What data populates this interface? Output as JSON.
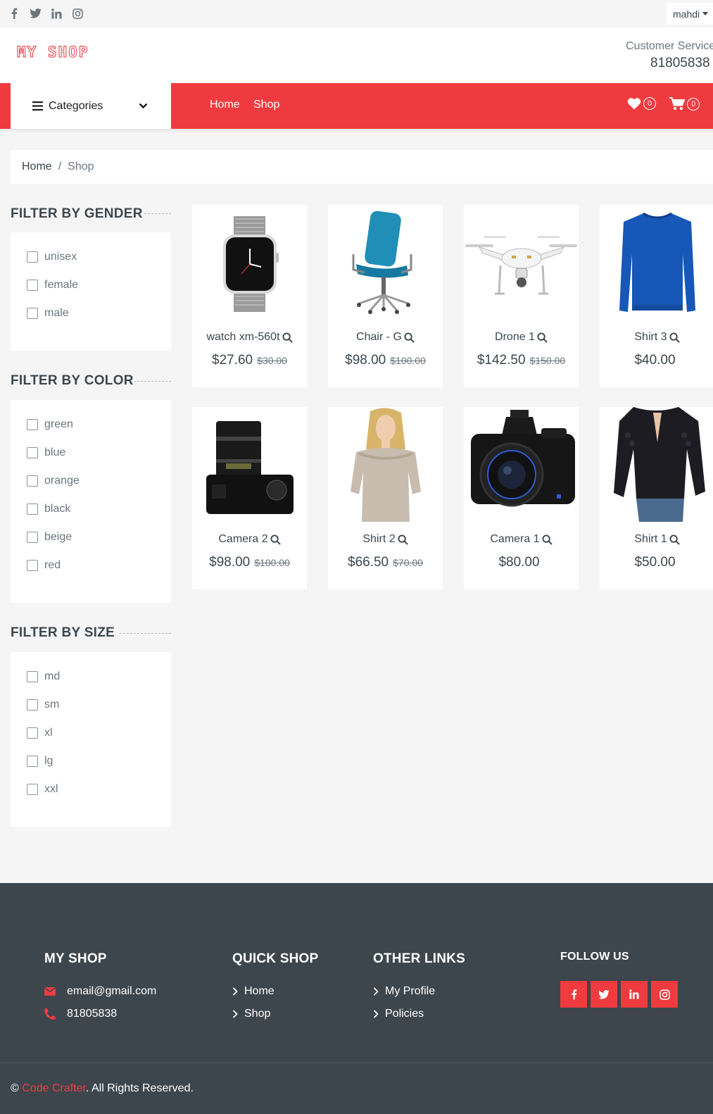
{
  "topbar": {
    "social_icons": [
      "facebook-icon",
      "twitter-icon",
      "linkedin-icon",
      "instagram-icon"
    ],
    "user_menu": "mahdi"
  },
  "header": {
    "logo": "MY SHOP",
    "customer_service_label": "Customer Service",
    "customer_service_phone": "81805838"
  },
  "nav": {
    "categories_label": "Categories",
    "links": [
      "Home",
      "Shop"
    ],
    "wishlist_count": "0",
    "cart_count": "0"
  },
  "breadcrumb": {
    "items": [
      "Home",
      "Shop"
    ],
    "separator": "/"
  },
  "filters": {
    "gender": {
      "title": "FILTER BY GENDER",
      "options": [
        "unisex",
        "female",
        "male"
      ]
    },
    "color": {
      "title": "FILTER BY COLOR",
      "options": [
        "green",
        "blue",
        "orange",
        "black",
        "beige",
        "red"
      ]
    },
    "size": {
      "title": "FILTER BY SIZE",
      "options": [
        "md",
        "sm",
        "xl",
        "lg",
        "xxl"
      ]
    }
  },
  "products": [
    {
      "name": "watch xm-560t",
      "price": "$27.60",
      "old_price": "$30.00"
    },
    {
      "name": "Chair - G",
      "price": "$98.00",
      "old_price": "$100.00"
    },
    {
      "name": "Drone 1",
      "price": "$142.50",
      "old_price": "$150.00"
    },
    {
      "name": "Shirt 3",
      "price": "$40.00",
      "old_price": ""
    },
    {
      "name": "Camera 2",
      "price": "$98.00",
      "old_price": "$100.00"
    },
    {
      "name": "Shirt 2",
      "price": "$66.50",
      "old_price": "$70.00"
    },
    {
      "name": "Camera 1",
      "price": "$80.00",
      "old_price": ""
    },
    {
      "name": "Shirt 1",
      "price": "$50.00",
      "old_price": ""
    }
  ],
  "footer": {
    "myshop": {
      "title": "MY SHOP",
      "email": "email@gmail.com",
      "phone": "81805838"
    },
    "quick_shop": {
      "title": "QUICK SHOP",
      "links": [
        "Home",
        "Shop"
      ]
    },
    "other_links": {
      "title": "OTHER LINKS",
      "links": [
        "My Profile",
        "Policies"
      ]
    },
    "follow_us": {
      "title": "FOLLOW US",
      "icons": [
        "facebook-icon",
        "twitter-icon",
        "linkedin-icon",
        "instagram-icon"
      ]
    },
    "copyright_prefix": "©",
    "copyright_brand": "Code Crafter",
    "copyright_suffix": ". All Rights Reserved."
  },
  "colors": {
    "accent": "#ef3b3f",
    "footer_bg": "#3d464d",
    "page_bg": "#f5f5f5",
    "text": "#3d464d"
  }
}
